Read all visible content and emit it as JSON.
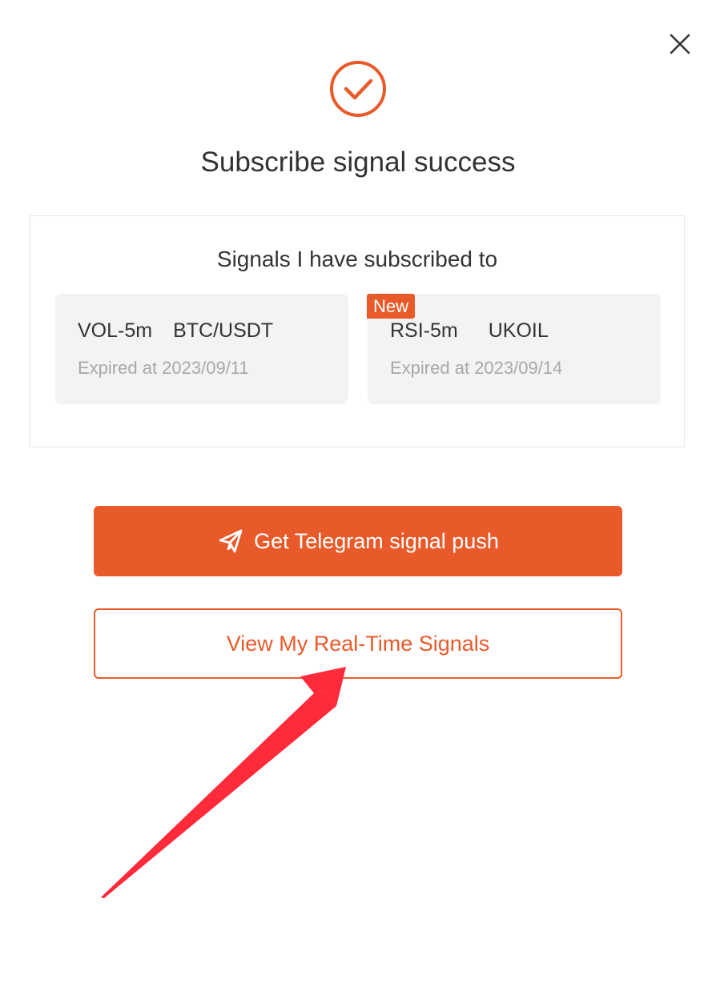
{
  "dialog": {
    "title": "Subscribe signal success",
    "close_icon": "close-icon",
    "success_icon": "check-circle-icon"
  },
  "subscriptions": {
    "heading": "Signals I have subscribed to",
    "items": [
      {
        "indicator": "VOL-5m",
        "pair": "BTC/USDT",
        "expiry": "Expired at 2023/09/11",
        "badge": ""
      },
      {
        "indicator": "RSI-5m",
        "pair": "UKOIL",
        "expiry": "Expired at 2023/09/14",
        "badge": "New"
      }
    ]
  },
  "actions": {
    "telegram_label": "Get Telegram signal push",
    "telegram_icon": "paper-plane-icon",
    "realtime_label": "View My Real-Time Signals"
  },
  "annotation": {
    "arrow_icon": "red-arrow-icon"
  },
  "colors": {
    "accent": "#e85a2a",
    "card_bg": "#f3f3f3",
    "arrow": "#ff2a3a"
  }
}
